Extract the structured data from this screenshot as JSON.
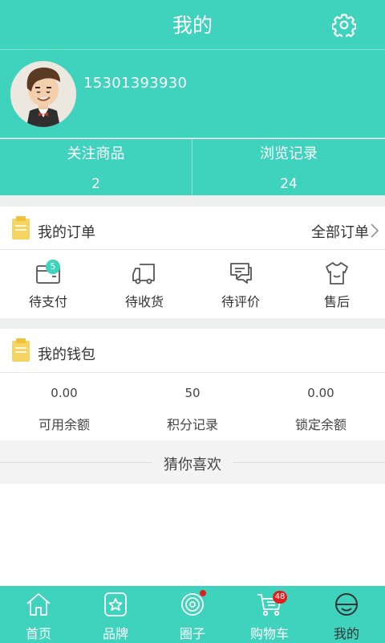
{
  "header": {
    "title": "我的",
    "settings_icon": "gear-icon"
  },
  "profile": {
    "avatar_icon": "user-avatar",
    "phone": "15301393930"
  },
  "stats": [
    {
      "label": "关注商品",
      "value": "2"
    },
    {
      "label": "浏览记录",
      "value": "24"
    }
  ],
  "orders": {
    "title": "我的订单",
    "all_label": "全部订单",
    "items": [
      {
        "label": "待支付",
        "icon": "wallet-icon",
        "badge": "5"
      },
      {
        "label": "待收货",
        "icon": "truck-icon"
      },
      {
        "label": "待评价",
        "icon": "comment-icon"
      },
      {
        "label": "售后",
        "icon": "shirt-icon"
      }
    ]
  },
  "wallet": {
    "title": "我的钱包",
    "items": [
      {
        "value": "0.00",
        "label": "可用余额"
      },
      {
        "value": "50",
        "label": "积分记录"
      },
      {
        "value": "0.00",
        "label": "锁定余额"
      }
    ]
  },
  "guess": {
    "label": "猜你喜欢"
  },
  "tabbar": {
    "items": [
      {
        "label": "首页",
        "icon": "home-icon"
      },
      {
        "label": "品牌",
        "icon": "brand-icon"
      },
      {
        "label": "圈子",
        "icon": "circle-icon",
        "dot": true
      },
      {
        "label": "购物车",
        "icon": "cart-icon",
        "count": "48"
      },
      {
        "label": "我的",
        "icon": "profile-icon",
        "active": true
      }
    ]
  },
  "colors": {
    "accent": "#3fd3bd",
    "badge_red": "#e02020",
    "clipboard_yellow": "#f6d464"
  }
}
